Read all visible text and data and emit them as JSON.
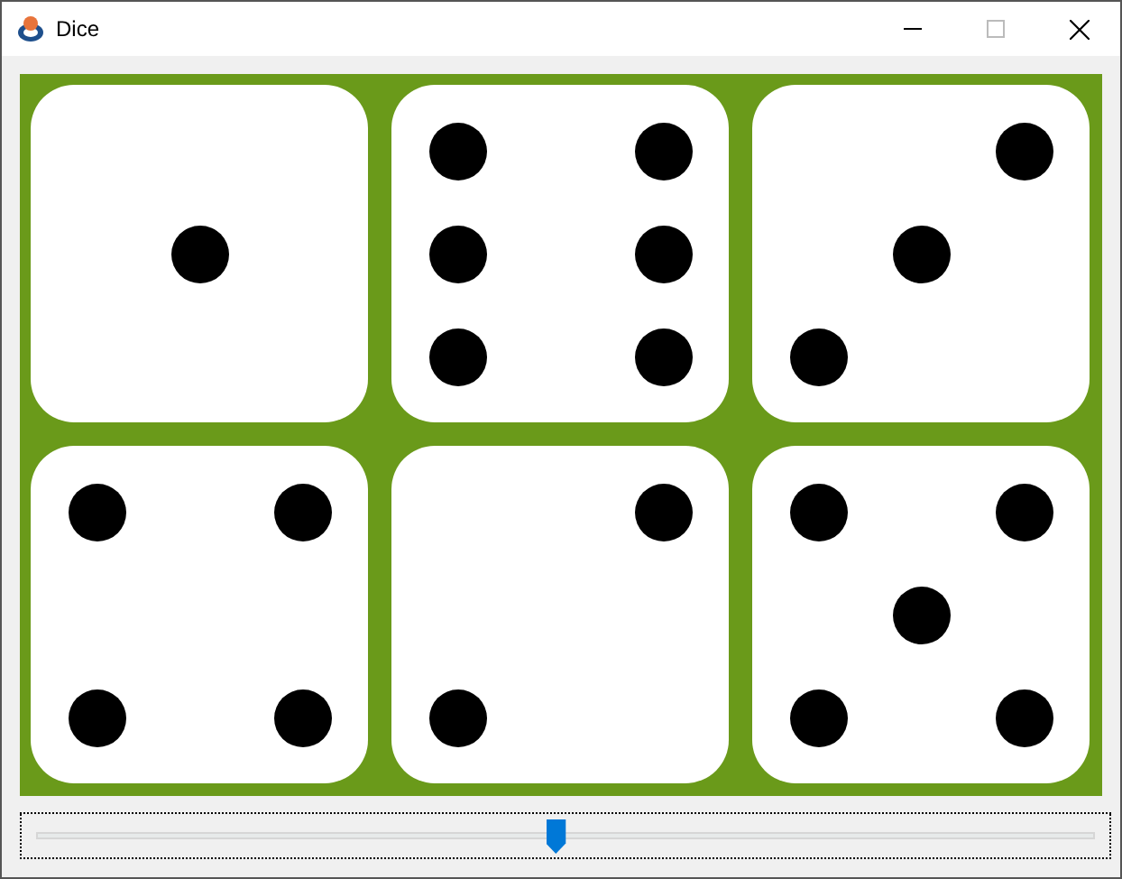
{
  "window": {
    "title": "Dice"
  },
  "dice": [
    {
      "kind": "one"
    },
    {
      "kind": "six"
    },
    {
      "kind": "three"
    },
    {
      "kind": "four"
    },
    {
      "kind": "two"
    },
    {
      "kind": "five"
    }
  ],
  "slider": {
    "level": 0.49
  }
}
